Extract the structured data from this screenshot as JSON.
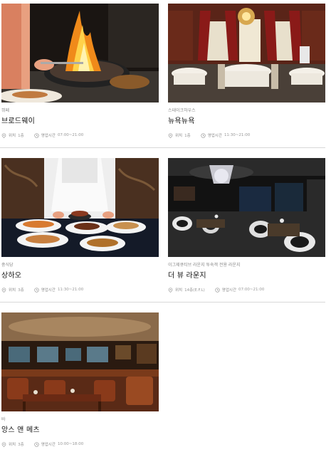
{
  "restaurants": [
    {
      "category": "뷔페",
      "name": "브로드웨이",
      "location_label": "위치",
      "location": "1층",
      "hours_label": "영업시간",
      "hours": "07:00~21:00"
    },
    {
      "category": "스테이크하우스",
      "name": "뉴욕뉴욕",
      "location_label": "위치",
      "location": "1층",
      "hours_label": "영업시간",
      "hours": "11:30~21:00"
    },
    {
      "category": "중식당",
      "name": "상하오",
      "location_label": "위치",
      "location": "3층",
      "hours_label": "영업시간",
      "hours": "11:30~21:00"
    },
    {
      "category": "이그제큐티브 라운지 투숙객 전용 라운지",
      "name": "더 뷰 라운지",
      "location_label": "위치",
      "location": "14층(E.F.L)",
      "hours_label": "영업시간",
      "hours": "07:00~21:00"
    },
    {
      "category": "바",
      "name": "앙스 앤 메츠",
      "location_label": "위치",
      "location": "3층",
      "hours_label": "영업시간",
      "hours": "10:00~18:00"
    }
  ]
}
